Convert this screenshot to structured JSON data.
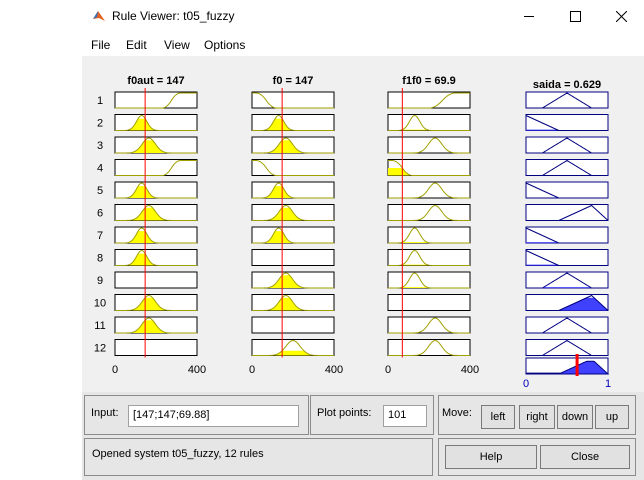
{
  "window": {
    "title": "Rule Viewer: t05_fuzzy"
  },
  "menu": {
    "items": [
      "File",
      "Edit",
      "View",
      "Options"
    ]
  },
  "inputs": [
    {
      "label": "f0aut = 147",
      "value": 147,
      "range": [
        0,
        400
      ],
      "tick_min": "0",
      "tick_max": "400"
    },
    {
      "label": "f0 = 147",
      "value": 147,
      "range": [
        0,
        400
      ],
      "tick_min": "0",
      "tick_max": "400"
    },
    {
      "label": "f1f0 = 69.9",
      "value": 69.9,
      "range": [
        0,
        400
      ],
      "tick_min": "0",
      "tick_max": "400"
    }
  ],
  "output": {
    "label": "saida = 0.629",
    "value": 0.629,
    "range": [
      0,
      1
    ],
    "tick_min": "0",
    "tick_max": "1"
  },
  "rules": [
    {
      "number": "1",
      "mfs": [
        {
          "type": "smf",
          "p": [
            230,
            320
          ]
        },
        {
          "type": "zmf",
          "p": [
            20,
            120
          ]
        },
        {
          "type": "smf",
          "p": [
            200,
            330
          ]
        }
      ],
      "out": {
        "type": "tri",
        "p": [
          0.2,
          0.5,
          0.8
        ]
      }
    },
    {
      "number": "2",
      "mfs": [
        {
          "type": "gauss",
          "c": 130,
          "s": 25
        },
        {
          "type": "gauss",
          "c": 130,
          "s": 25
        },
        {
          "type": "gauss",
          "c": 130,
          "s": 25
        }
      ],
      "out": {
        "type": "tri",
        "p": [
          -0.2,
          0,
          0.4
        ]
      }
    },
    {
      "number": "3",
      "mfs": [
        {
          "type": "gauss",
          "c": 165,
          "s": 32
        },
        {
          "type": "gauss",
          "c": 165,
          "s": 32
        },
        {
          "type": "gauss",
          "c": 230,
          "s": 32
        }
      ],
      "out": {
        "type": "tri",
        "p": [
          0.2,
          0.5,
          0.8
        ]
      }
    },
    {
      "number": "4",
      "mfs": [
        {
          "type": "smf",
          "p": [
            230,
            320
          ]
        },
        {
          "type": "zmf",
          "p": [
            20,
            120
          ]
        },
        {
          "type": "zmf",
          "p": [
            20,
            120
          ]
        }
      ],
      "out": {
        "type": "tri",
        "p": [
          0.2,
          0.5,
          0.8
        ]
      }
    },
    {
      "number": "5",
      "mfs": [
        {
          "type": "gauss",
          "c": 130,
          "s": 25
        },
        {
          "type": "gauss",
          "c": 130,
          "s": 25
        },
        {
          "type": "gauss",
          "c": 230,
          "s": 32
        }
      ],
      "out": {
        "type": "tri",
        "p": [
          -0.2,
          0,
          0.4
        ]
      }
    },
    {
      "number": "6",
      "mfs": [
        {
          "type": "gauss",
          "c": 165,
          "s": 32
        },
        {
          "type": "gauss",
          "c": 165,
          "s": 32
        },
        {
          "type": "gauss",
          "c": 230,
          "s": 32
        }
      ],
      "out": {
        "type": "tri",
        "p": [
          0.4,
          0.8,
          1.0
        ]
      }
    },
    {
      "number": "7",
      "mfs": [
        {
          "type": "gauss",
          "c": 130,
          "s": 25
        },
        {
          "type": "gauss",
          "c": 130,
          "s": 25
        },
        {
          "type": "gauss",
          "c": 130,
          "s": 25
        }
      ],
      "out": {
        "type": "tri",
        "p": [
          -0.2,
          0,
          0.4
        ]
      }
    },
    {
      "number": "8",
      "mfs": [
        {
          "type": "gauss",
          "c": 130,
          "s": 25
        },
        {
          "type": "none"
        },
        {
          "type": "gauss",
          "c": 130,
          "s": 25
        }
      ],
      "out": {
        "type": "tri",
        "p": [
          -0.2,
          0,
          0.4
        ]
      }
    },
    {
      "number": "9",
      "mfs": [
        {
          "type": "none"
        },
        {
          "type": "gauss",
          "c": 165,
          "s": 32
        },
        {
          "type": "gauss",
          "c": 130,
          "s": 25
        }
      ],
      "out": {
        "type": "tri",
        "p": [
          0.2,
          0.5,
          0.8
        ]
      }
    },
    {
      "number": "10",
      "mfs": [
        {
          "type": "gauss",
          "c": 165,
          "s": 32
        },
        {
          "type": "gauss",
          "c": 165,
          "s": 32
        },
        {
          "type": "none"
        }
      ],
      "out": {
        "type": "tri",
        "p": [
          0.4,
          0.8,
          1.0
        ]
      }
    },
    {
      "number": "11",
      "mfs": [
        {
          "type": "gauss",
          "c": 165,
          "s": 32
        },
        {
          "type": "none"
        },
        {
          "type": "gauss",
          "c": 230,
          "s": 32
        }
      ],
      "out": {
        "type": "tri",
        "p": [
          0.2,
          0.5,
          0.8
        ]
      }
    },
    {
      "number": "12",
      "mfs": [
        {
          "type": "none"
        },
        {
          "type": "gauss",
          "c": 200,
          "s": 35
        },
        {
          "type": "gauss",
          "c": 230,
          "s": 32
        }
      ],
      "out": {
        "type": "tri",
        "p": [
          0.2,
          0.5,
          0.8
        ]
      }
    }
  ],
  "colors": {
    "mf_line": "#a0a000",
    "fill": "#ffff00",
    "out_fill": "#4040ff",
    "out_line": "#000080",
    "cursor": "#ff0000"
  },
  "input_panel": {
    "label": "Input:",
    "value": "[147;147;69.88]"
  },
  "plot_points": {
    "label": "Plot points:",
    "value": "101"
  },
  "move": {
    "label": "Move:",
    "buttons": [
      "left",
      "right",
      "down",
      "up"
    ]
  },
  "status": {
    "text": "Opened system t05_fuzzy, 12 rules"
  },
  "buttons": {
    "help": "Help",
    "close": "Close"
  }
}
